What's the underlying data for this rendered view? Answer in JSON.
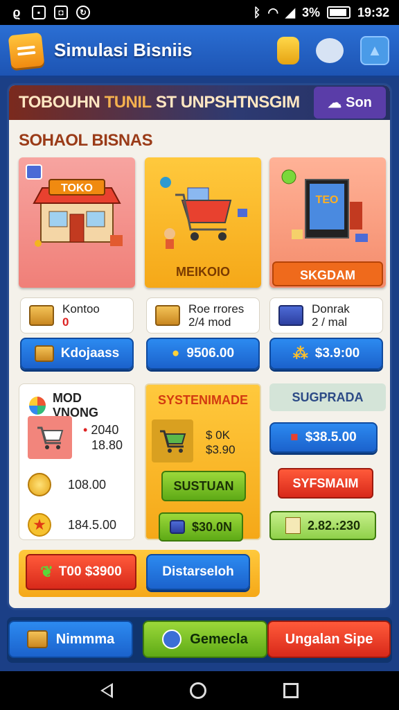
{
  "status_bar": {
    "time": "19:32",
    "battery_text": "3%",
    "icons": [
      "notification-icon",
      "gallery-icon",
      "photo-icon",
      "sync-icon",
      "bluetooth-icon",
      "wifi-icon",
      "signal-icon",
      "battery-icon"
    ]
  },
  "app_bar": {
    "title": "Simulasi Bisniis",
    "actions": [
      "coins-icon",
      "cloud-icon",
      "home-icon"
    ]
  },
  "banner": {
    "title_a": "TOBOUHN",
    "title_b": "TUNIL",
    "title_c": "ST UNPSHTNSGIM",
    "button_label": "Son"
  },
  "section_title": "SOHAOL BISNAS",
  "businesses": [
    {
      "caption": "TOKO",
      "sign": "TOKO"
    },
    {
      "caption": "MEIKOIO"
    },
    {
      "caption": "SKGDAM",
      "sign": "TEO"
    }
  ],
  "info_cards": [
    {
      "line1": "Kontoo",
      "line2": "0"
    },
    {
      "line1": "Roe rrores",
      "line2": "2/4 mod"
    },
    {
      "line1": "Donrak",
      "line2": "2 / mal"
    }
  ],
  "blue_buttons": [
    "Kdojaass",
    "9506.00",
    "$3.9:00"
  ],
  "mod_card": {
    "title": "MOD VNONG",
    "rows": [
      {
        "line1": "2040",
        "line2": "18.80"
      },
      {
        "value": "108.00"
      },
      {
        "value": "184.5.00"
      }
    ]
  },
  "sys_card": {
    "title": "SYSTENIMADE",
    "price_line1": "$ 0K",
    "price_line2": "$3.90",
    "button_1": "SUSTUAN",
    "button_2": "$30.0N"
  },
  "sup_card": {
    "title": "SUGPRADA",
    "button_1": "$38.5.00",
    "button_2": "SYFSMAIM",
    "button_3": "2.82.:230"
  },
  "bottom_strip": {
    "red_button": "T00 $3900",
    "blue_button": "Distarseloh"
  },
  "tabs": [
    {
      "label": "Nimmma"
    },
    {
      "label": "Gemecla"
    },
    {
      "label": "Ungalan Sipe"
    }
  ]
}
